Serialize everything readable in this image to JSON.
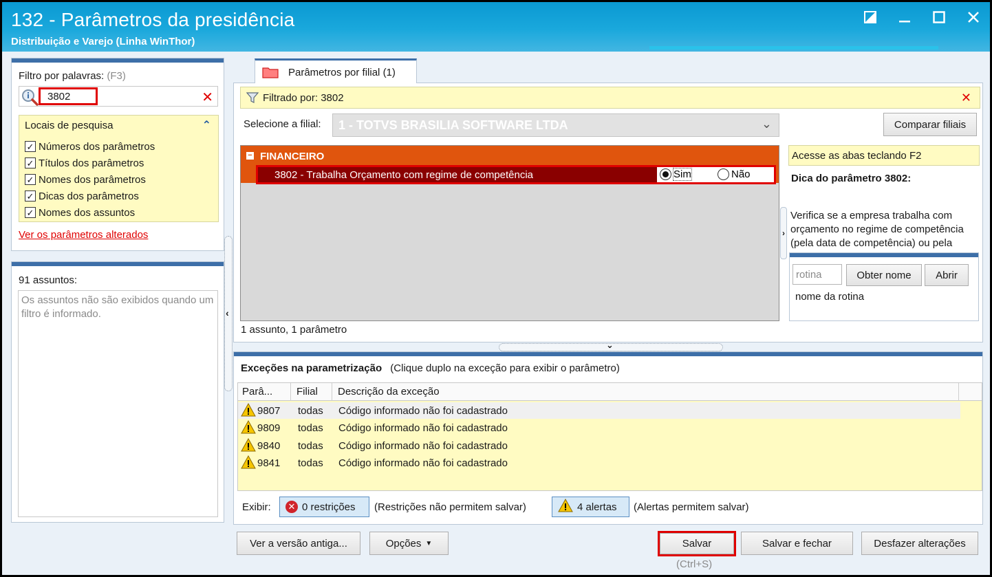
{
  "window": {
    "title": "132 - Parâmetros da presidência",
    "subtitle": "Distribuição e Varejo (Linha WinThor)"
  },
  "filter": {
    "label": "Filtro por palavras:",
    "shortcut": "(F3)",
    "value": "3802",
    "locais_title": "Locais de pesquisa",
    "options": [
      {
        "label": "Números dos parâmetros",
        "checked": true
      },
      {
        "label": "Títulos dos parâmetros",
        "checked": true
      },
      {
        "label": "Nomes dos parâmetros",
        "checked": true
      },
      {
        "label": "Dicas dos parâmetros",
        "checked": true
      },
      {
        "label": "Nomes dos assuntos",
        "checked": true
      }
    ],
    "changed_link": "Ver os parâmetros alterados"
  },
  "subjects": {
    "count_label": "91 assuntos:",
    "empty_message": "Os assuntos não são exibidos quando um filtro é informado."
  },
  "tab": {
    "label": "Parâmetros por filial",
    "count": "(1)"
  },
  "filtered_by": "Filtrado por: 3802",
  "branch": {
    "label": "Selecione a filial:",
    "value": "1 - TOTVS BRASILIA SOFTWARE LTDA",
    "compare_button": "Comparar filiais"
  },
  "tree": {
    "group": "FINANCEIRO",
    "param_label": "3802 - Trabalha Orçamento com regime de competência",
    "option_yes": "Sim",
    "option_no": "Não",
    "selected": "Sim",
    "summary": "1 assunto, 1 parâmetro"
  },
  "tip": {
    "shortcut_hint": "Acesse as abas teclando F2",
    "title": "Dica do parâmetro 3802:",
    "text": "Verifica se a empresa trabalha com orçamento no regime de competência (pela data de competência) ou pela",
    "rotina_placeholder": "rotina",
    "get_name_button": "Obter nome",
    "open_button": "Abrir",
    "rotina_name": "nome da rotina"
  },
  "exceptions": {
    "title": "Exceções na parametrização",
    "hint": "(Clique duplo na exceção para exibir o parâmetro)",
    "columns": [
      "Parâ...",
      "Filial",
      "Descrição da exceção"
    ],
    "rows": [
      {
        "param": "9807",
        "filial": "todas",
        "desc": "Código informado não foi cadastrado"
      },
      {
        "param": "9809",
        "filial": "todas",
        "desc": "Código informado não foi cadastrado"
      },
      {
        "param": "9840",
        "filial": "todas",
        "desc": "Código informado não foi cadastrado"
      },
      {
        "param": "9841",
        "filial": "todas",
        "desc": "Código informado não foi cadastrado"
      }
    ],
    "exibir_label": "Exibir:",
    "restrictions_button": "0 restrições",
    "restrictions_desc": "(Restrições não permitem salvar)",
    "alerts_button": "4 alertas",
    "alerts_desc": "(Alertas permitem salvar)"
  },
  "footer": {
    "old_version_button": "Ver a versão antiga...",
    "options_button": "Opções",
    "save_button": "Salvar",
    "save_shortcut": "(Ctrl+S)",
    "save_close_button": "Salvar e fechar",
    "undo_button": "Desfazer alterações"
  },
  "colors": {
    "title_bar": "#0a99d2",
    "group_header": "#e0550d",
    "selected_row": "#8a0000",
    "highlight_frame": "#e00000",
    "hint_yellow": "#fffbc2"
  }
}
